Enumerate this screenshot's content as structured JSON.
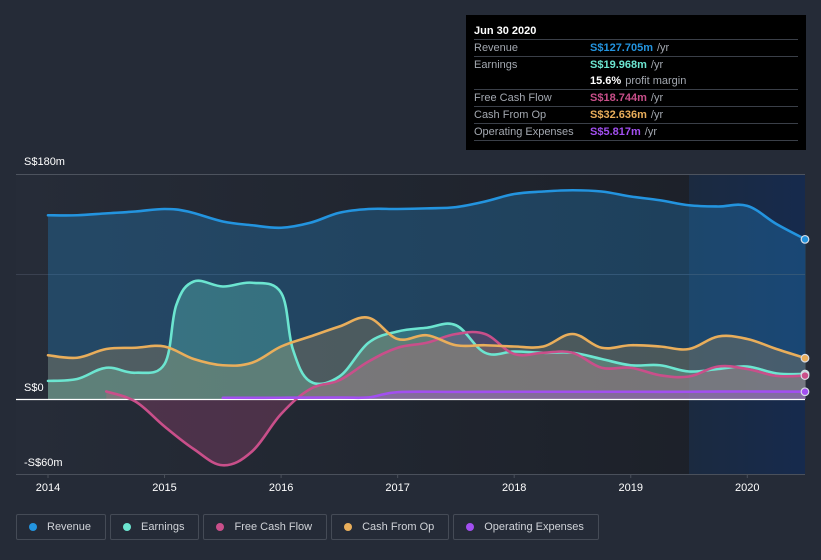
{
  "tooltip": {
    "date": "Jun 30 2020",
    "rows": [
      {
        "label": "Revenue",
        "value": "S$127.705m",
        "unit": "/yr",
        "color": "#2394df"
      },
      {
        "label": "Earnings",
        "value": "S$19.968m",
        "unit": "/yr",
        "color": "#6ce5d0"
      },
      {
        "label": "",
        "value": "15.6%",
        "unit": "profit margin",
        "color": "#ffffff"
      },
      {
        "label": "Free Cash Flow",
        "value": "S$18.744m",
        "unit": "/yr",
        "color": "#c94f8a"
      },
      {
        "label": "Cash From Op",
        "value": "S$32.636m",
        "unit": "/yr",
        "color": "#e9ae5b"
      },
      {
        "label": "Operating Expenses",
        "value": "S$5.817m",
        "unit": "/yr",
        "color": "#a24ff0"
      }
    ]
  },
  "legend": [
    {
      "label": "Revenue",
      "color": "#2394df"
    },
    {
      "label": "Earnings",
      "color": "#6ce5d0"
    },
    {
      "label": "Free Cash Flow",
      "color": "#c94f8a"
    },
    {
      "label": "Cash From Op",
      "color": "#e9ae5b"
    },
    {
      "label": "Operating Expenses",
      "color": "#a24ff0"
    }
  ],
  "chart_data": {
    "type": "area",
    "title": "",
    "xlabel": "",
    "ylabel": "",
    "currency": "SGD",
    "ylim": [
      -60,
      180
    ],
    "xlim": [
      2013.73,
      2020.5
    ],
    "y_ticks": [
      {
        "value": 180,
        "label": "S$180m"
      },
      {
        "value": 0,
        "label": "S$0"
      },
      {
        "value": -60,
        "label": "-S$60m"
      }
    ],
    "x_ticks": [
      {
        "value": 2014,
        "label": "2014"
      },
      {
        "value": 2015,
        "label": "2015"
      },
      {
        "value": 2016,
        "label": "2016"
      },
      {
        "value": 2017,
        "label": "2017"
      },
      {
        "value": 2018,
        "label": "2018"
      },
      {
        "value": 2019,
        "label": "2019"
      },
      {
        "value": 2020,
        "label": "2020"
      }
    ],
    "gridlines": [
      180,
      100
    ],
    "highlight_range": [
      2019.5,
      2020.5
    ],
    "series": [
      {
        "name": "Revenue",
        "color": "#2394df",
        "points": [
          [
            2014,
            147
          ],
          [
            2014.25,
            147
          ],
          [
            2014.5,
            148.5
          ],
          [
            2014.75,
            150
          ],
          [
            2015,
            152
          ],
          [
            2015.2,
            150
          ],
          [
            2015.5,
            142
          ],
          [
            2015.75,
            139
          ],
          [
            2016,
            137
          ],
          [
            2016.25,
            141
          ],
          [
            2016.5,
            149
          ],
          [
            2016.75,
            152
          ],
          [
            2017,
            152
          ],
          [
            2017.25,
            152.5
          ],
          [
            2017.5,
            153.5
          ],
          [
            2017.75,
            158
          ],
          [
            2018,
            164
          ],
          [
            2018.25,
            166
          ],
          [
            2018.5,
            167
          ],
          [
            2018.75,
            166
          ],
          [
            2019,
            162
          ],
          [
            2019.25,
            159
          ],
          [
            2019.5,
            155
          ],
          [
            2019.75,
            154
          ],
          [
            2020,
            154.5
          ],
          [
            2020.25,
            140
          ],
          [
            2020.5,
            127.7
          ]
        ]
      },
      {
        "name": "Earnings",
        "color": "#6ce5d0",
        "points": [
          [
            2014,
            14.5
          ],
          [
            2014.25,
            16
          ],
          [
            2014.5,
            25
          ],
          [
            2014.75,
            21
          ],
          [
            2015,
            28
          ],
          [
            2015.1,
            75
          ],
          [
            2015.25,
            94
          ],
          [
            2015.5,
            90
          ],
          [
            2015.75,
            93
          ],
          [
            2016,
            85
          ],
          [
            2016.1,
            40
          ],
          [
            2016.25,
            14
          ],
          [
            2016.5,
            18
          ],
          [
            2016.75,
            45
          ],
          [
            2017,
            54
          ],
          [
            2017.25,
            57
          ],
          [
            2017.5,
            59
          ],
          [
            2017.75,
            37
          ],
          [
            2018,
            38
          ],
          [
            2018.25,
            37
          ],
          [
            2018.5,
            37
          ],
          [
            2018.75,
            32
          ],
          [
            2019,
            27
          ],
          [
            2019.25,
            27
          ],
          [
            2019.5,
            22
          ],
          [
            2019.75,
            24
          ],
          [
            2020,
            26
          ],
          [
            2020.25,
            20.5
          ],
          [
            2020.5,
            19.97
          ]
        ]
      },
      {
        "name": "Free Cash Flow",
        "color": "#c94f8a",
        "points": [
          [
            2014.5,
            6
          ],
          [
            2014.75,
            -2
          ],
          [
            2015,
            -22
          ],
          [
            2015.25,
            -40
          ],
          [
            2015.5,
            -53
          ],
          [
            2015.75,
            -42
          ],
          [
            2016,
            -12
          ],
          [
            2016.25,
            8
          ],
          [
            2016.5,
            15
          ],
          [
            2016.75,
            30
          ],
          [
            2017,
            41
          ],
          [
            2017.25,
            45
          ],
          [
            2017.5,
            52
          ],
          [
            2017.75,
            52
          ],
          [
            2018,
            36
          ],
          [
            2018.25,
            37
          ],
          [
            2018.5,
            37
          ],
          [
            2018.75,
            25
          ],
          [
            2019,
            25
          ],
          [
            2019.25,
            19
          ],
          [
            2019.5,
            18
          ],
          [
            2019.75,
            26
          ],
          [
            2020,
            24
          ],
          [
            2020.25,
            18.5
          ],
          [
            2020.5,
            18.74
          ]
        ]
      },
      {
        "name": "Cash From Op",
        "color": "#e9ae5b",
        "points": [
          [
            2014,
            35
          ],
          [
            2014.25,
            33
          ],
          [
            2014.5,
            40
          ],
          [
            2014.75,
            41
          ],
          [
            2015,
            42
          ],
          [
            2015.25,
            32
          ],
          [
            2015.5,
            27
          ],
          [
            2015.75,
            29
          ],
          [
            2016,
            42
          ],
          [
            2016.25,
            50
          ],
          [
            2016.5,
            58
          ],
          [
            2016.75,
            65
          ],
          [
            2017,
            48
          ],
          [
            2017.25,
            51
          ],
          [
            2017.5,
            43
          ],
          [
            2017.75,
            43
          ],
          [
            2018,
            42
          ],
          [
            2018.25,
            42
          ],
          [
            2018.5,
            52
          ],
          [
            2018.75,
            41
          ],
          [
            2019,
            43
          ],
          [
            2019.25,
            42
          ],
          [
            2019.5,
            40
          ],
          [
            2019.75,
            50
          ],
          [
            2020,
            48
          ],
          [
            2020.25,
            40
          ],
          [
            2020.5,
            32.64
          ]
        ]
      },
      {
        "name": "Operating Expenses",
        "color": "#a24ff0",
        "points": [
          [
            2015.5,
            1
          ],
          [
            2016,
            1
          ],
          [
            2016.5,
            1.2
          ],
          [
            2016.75,
            1.3
          ],
          [
            2017,
            5.5
          ],
          [
            2017.5,
            5.7
          ],
          [
            2018,
            5.8
          ],
          [
            2018.5,
            5.8
          ],
          [
            2019,
            5.8
          ],
          [
            2019.5,
            5.8
          ],
          [
            2020,
            6
          ],
          [
            2020.5,
            5.82
          ]
        ]
      }
    ]
  }
}
